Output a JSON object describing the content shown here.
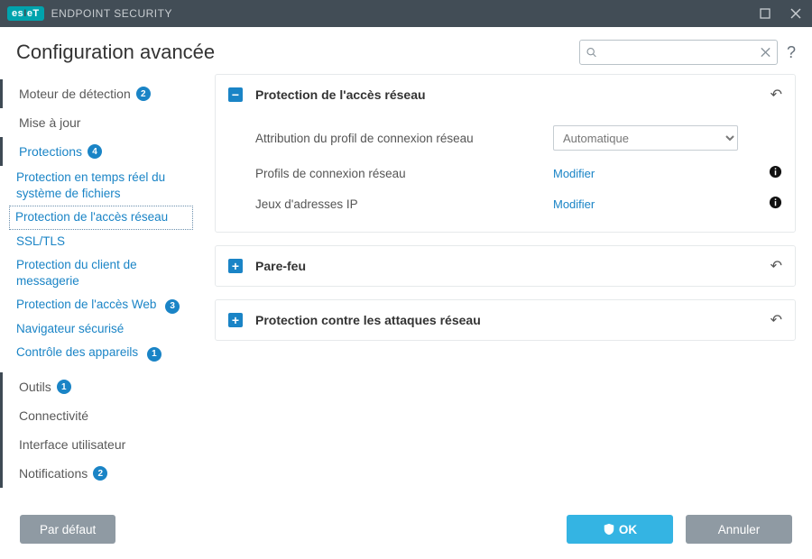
{
  "window": {
    "brand_prefix": "es",
    "brand_suffix": "eT",
    "product": "ENDPOINT SECURITY"
  },
  "header": {
    "title": "Configuration avancée",
    "search_placeholder": ""
  },
  "sidebar": {
    "detection": {
      "label": "Moteur de détection",
      "badge": "2"
    },
    "update": {
      "label": "Mise à jour"
    },
    "protections": {
      "label": "Protections",
      "badge": "4"
    },
    "sub": {
      "realtime": "Protection en temps réel du système de fichiers",
      "network_access": "Protection de l'accès réseau",
      "ssl": "SSL/TLS",
      "mail": "Protection du client de messagerie",
      "web_label": "Protection de l'accès Web",
      "web_badge": "3",
      "browser": "Navigateur sécurisé",
      "devices_label": "Contrôle des appareils",
      "devices_badge": "1"
    },
    "tools": {
      "label": "Outils",
      "badge": "1"
    },
    "connectivity": {
      "label": "Connectivité"
    },
    "ui": {
      "label": "Interface utilisateur"
    },
    "notifications": {
      "label": "Notifications",
      "badge": "2"
    }
  },
  "panels": {
    "network_access": {
      "title": "Protection de l'accès réseau",
      "rows": {
        "profile_assign": {
          "label": "Attribution du profil de connexion réseau",
          "value": "Automatique"
        },
        "profiles": {
          "label": "Profils de connexion réseau",
          "action": "Modifier"
        },
        "ip_sets": {
          "label": "Jeux d'adresses IP",
          "action": "Modifier"
        }
      }
    },
    "firewall": {
      "title": "Pare-feu"
    },
    "network_attack": {
      "title": "Protection contre les attaques réseau"
    }
  },
  "footer": {
    "default": "Par défaut",
    "ok": "OK",
    "cancel": "Annuler"
  }
}
